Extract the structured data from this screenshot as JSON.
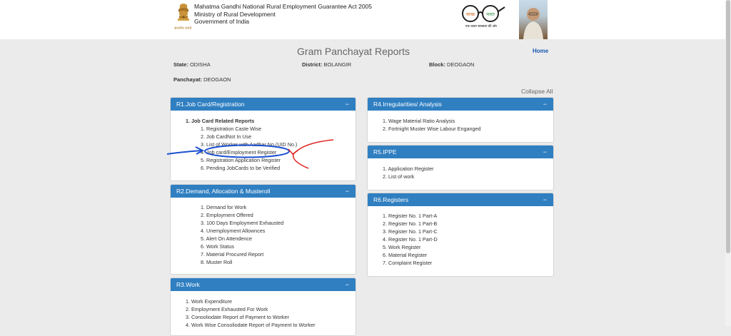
{
  "header": {
    "org_lines": [
      "Mahatma Gandhi National Rural Employment Guarantee Act 2005",
      "Ministry of Rural Development",
      "Government of India"
    ],
    "emblem_caption": "सत्यमेव जयते",
    "swachh_word1": "स्वच्छ",
    "swachh_word2": "भारत",
    "swachh_tagline": "एक कदम स्वच्छता की ओर"
  },
  "page": {
    "title": "Gram Panchayat Reports",
    "home_link": "Home",
    "collapse_all": "Collapse All"
  },
  "location": {
    "state_label": "State:",
    "state_value": "ODISHA",
    "district_label": "District:",
    "district_value": "BOLANGIR",
    "block_label": "Block:",
    "block_value": "DEOGAON",
    "panchayat_label": "Panchayat:",
    "panchayat_value": "DEOGAON"
  },
  "panels": {
    "r1": {
      "title": "R1.Job Card/Registration",
      "toggle": "−",
      "group_num": "1.",
      "group_title": "Job Card Related Reports",
      "items": [
        "Registration Caste Wise",
        "Job CardNot In Use",
        "List of Worker with Aadhar No.(UID No.)",
        "Job card/Employment Register",
        "Registration Application Register",
        "Pending JobCards to be Verified"
      ]
    },
    "r2": {
      "title": "R2.Demand, Allocation & Musteroll",
      "toggle": "−",
      "items": [
        "Demand for Work",
        "Employment Offered",
        "100 Days Employment Exhausted",
        "Unemployment Allownces",
        "Alert On Attendence",
        "Work Status",
        "Material Procured Report",
        "Muster Roll"
      ]
    },
    "r3": {
      "title": "R3.Work",
      "toggle": "−",
      "items": [
        "Work Expenditure",
        "Employment Exhausted For Work",
        "Consoliodate Report of Payment to Worker",
        "Work Wise Consoliodate Report of Payment to Worker"
      ]
    },
    "r4": {
      "title": "R4.Irregularities/ Analysis",
      "toggle": "−",
      "items": [
        "Wage Material Ratio Analysis",
        "Fortnight Muster Wise Labour Enganged"
      ]
    },
    "r5": {
      "title": "R5.IPPE",
      "toggle": "−",
      "items": [
        "Application Register",
        "List of work"
      ]
    },
    "r6": {
      "title": "R6.Registers",
      "toggle": "−",
      "items": [
        "Register No. 1 Part-A",
        "Register No. 1 Part-B",
        "Register No. 1 Part-C",
        "Register No. 1 Part-D",
        "Work Register",
        "Material Register",
        "Complaint Register"
      ]
    }
  },
  "colors": {
    "panel_header": "#2f7fc1",
    "annotation_blue": "#1b4fd1",
    "annotation_red": "#e02020",
    "link": "#1a56b0"
  }
}
